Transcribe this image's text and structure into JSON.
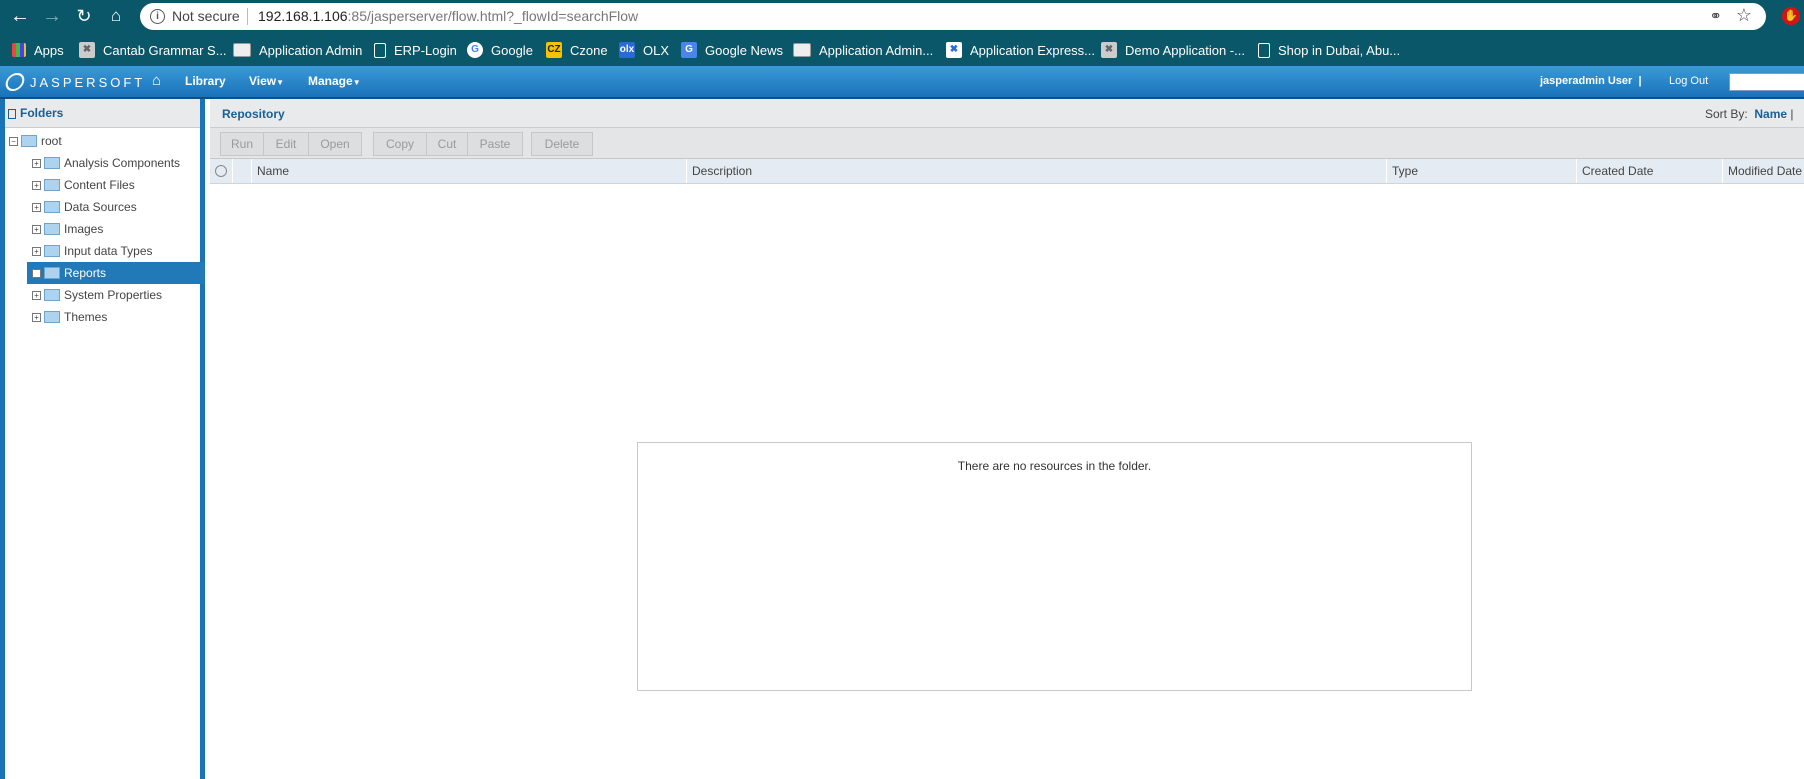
{
  "browser": {
    "not_secure": "Not secure",
    "url_main": "192.168.1.106",
    "url_rest": ":85/jasperserver/flow.html?_flowId=searchFlow",
    "bookmarks": [
      "Apps",
      "Cantab Grammar S...",
      "Application Admin",
      "ERP-Login",
      "Google",
      "Czone",
      "OLX",
      "Google News",
      "Application Admin...",
      "Application Express...",
      "Demo Application -...",
      "Shop in Dubai, Abu..."
    ]
  },
  "app": {
    "logo": "JASPERSOFT",
    "menu": [
      "Library",
      "View",
      "Manage"
    ],
    "user": "jasperadmin User",
    "logout": "Log Out"
  },
  "folders": {
    "title": "Folders",
    "root": "root",
    "items": [
      "Analysis Components",
      "Content Files",
      "Data Sources",
      "Images",
      "Input data Types",
      "Reports",
      "System Properties",
      "Themes"
    ],
    "selected": "Reports"
  },
  "repository": {
    "title": "Repository",
    "sort_by_label": "Sort By:",
    "sort_by_value": "Name",
    "buttons": [
      "Run",
      "Edit",
      "Open",
      "Copy",
      "Cut",
      "Paste",
      "Delete"
    ],
    "columns": [
      "Name",
      "Description",
      "Type",
      "Created Date",
      "Modified Date"
    ],
    "empty_message": "There are no resources in the folder."
  },
  "colors": {
    "chrome": "#0a5769",
    "header": "#1a72b8",
    "selected": "#2279b8",
    "title_text": "#1b5f94"
  }
}
